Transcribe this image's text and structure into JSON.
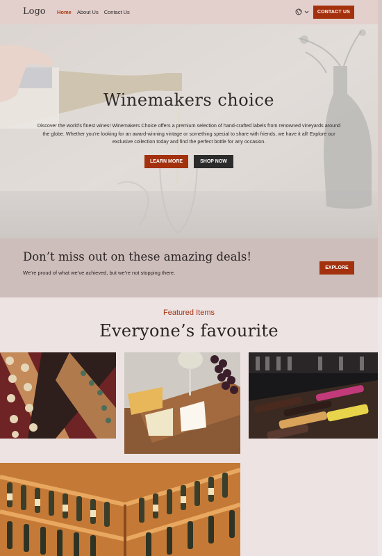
{
  "nav": {
    "logo": "Logo",
    "links": [
      "Home",
      "About Us",
      "Contact Us"
    ],
    "active": "Home",
    "language_icon": "globe-icon",
    "contact_label": "CONTACT US"
  },
  "hero": {
    "title": "Winemakers choice",
    "description": "Discover the world's finest wines! Winemakers Choice offers a premium selection of hand-crafted labels from renowned vineyards around the globe. Whether you're looking for an award-winning vintage or something special to share with friends, we have it all! Explore our exclusive collection today and find the perfect bottle for any occasion.",
    "learn_more_label": "LEARN MORE",
    "shop_now_label": "SHOP NOW"
  },
  "deals": {
    "title": "Don’t miss out on these amazing deals!",
    "subtitle": "We’re proud of what we’ve achieved, but we’re not stopping there.",
    "explore_label": "EXPLORE"
  },
  "featured": {
    "label": "Featured Items",
    "title": "Everyone’s favourite"
  },
  "colors": {
    "accent": "#a3310d",
    "dark_button": "#2b2b2b",
    "nav_bg": "#e3cfcb",
    "deals_bg": "#cdbebb",
    "page_bg": "#ede3e3"
  }
}
